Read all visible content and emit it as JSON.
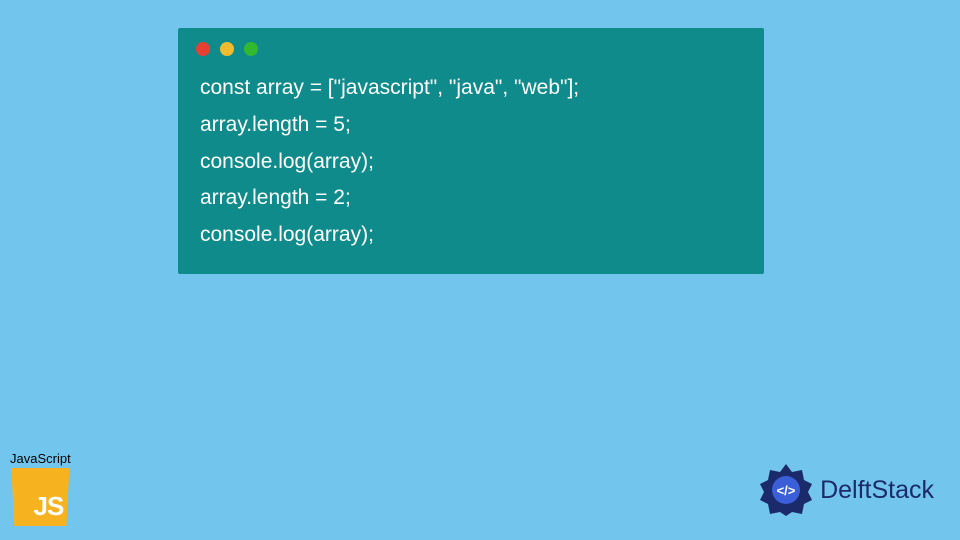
{
  "code": {
    "lines": [
      "const array = [\"javascript\", \"java\", \"web\"];",
      "array.length = 5;",
      "console.log(array);",
      "array.length = 2;",
      "console.log(array);"
    ]
  },
  "badges": {
    "js_label": "JavaScript",
    "js_logo_text": "JS",
    "delft_text": "DelftStack"
  },
  "colors": {
    "background": "#72c6ed",
    "code_window": "#0f8b8b",
    "dot_red": "#e64032",
    "dot_yellow": "#f0bb2f",
    "dot_green": "#33b92f",
    "js_logo": "#f7b21f",
    "delft_primary": "#1b2a6b"
  }
}
